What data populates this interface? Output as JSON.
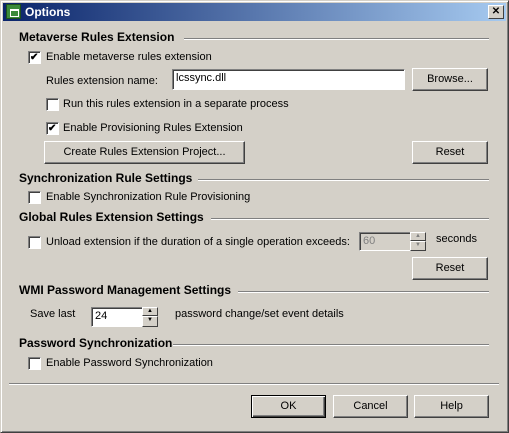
{
  "window": {
    "title": "Options"
  },
  "metaverse": {
    "title": "Metaverse Rules Extension",
    "enable_label": "Enable metaverse rules extension",
    "enable_checked": true,
    "rules_name_label": "Rules extension name:",
    "rules_name_value": "lcssync.dll",
    "browse_label": "Browse...",
    "separate_process_label": "Run this rules extension in a separate process",
    "separate_process_checked": false,
    "provisioning_label": "Enable Provisioning Rules Extension",
    "provisioning_checked": true,
    "create_project_label": "Create Rules Extension Project...",
    "reset_label": "Reset"
  },
  "sync_rules": {
    "title": "Synchronization Rule Settings",
    "enable_label": "Enable Synchronization Rule Provisioning",
    "enable_checked": false
  },
  "global_rules": {
    "title": "Global Rules Extension Settings",
    "unload_label": "Unload extension if the duration of a single operation exceeds:",
    "unload_checked": false,
    "unload_value": "60",
    "seconds_label": "seconds",
    "reset_label": "Reset"
  },
  "wmi": {
    "title": "WMI Password Management Settings",
    "save_last_label": "Save last",
    "save_last_value": "24",
    "details_label": "password change/set event details"
  },
  "password_sync": {
    "title": "Password Synchronization",
    "enable_label": "Enable Password Synchronization",
    "enable_checked": false
  },
  "footer": {
    "ok_label": "OK",
    "cancel_label": "Cancel",
    "help_label": "Help"
  }
}
